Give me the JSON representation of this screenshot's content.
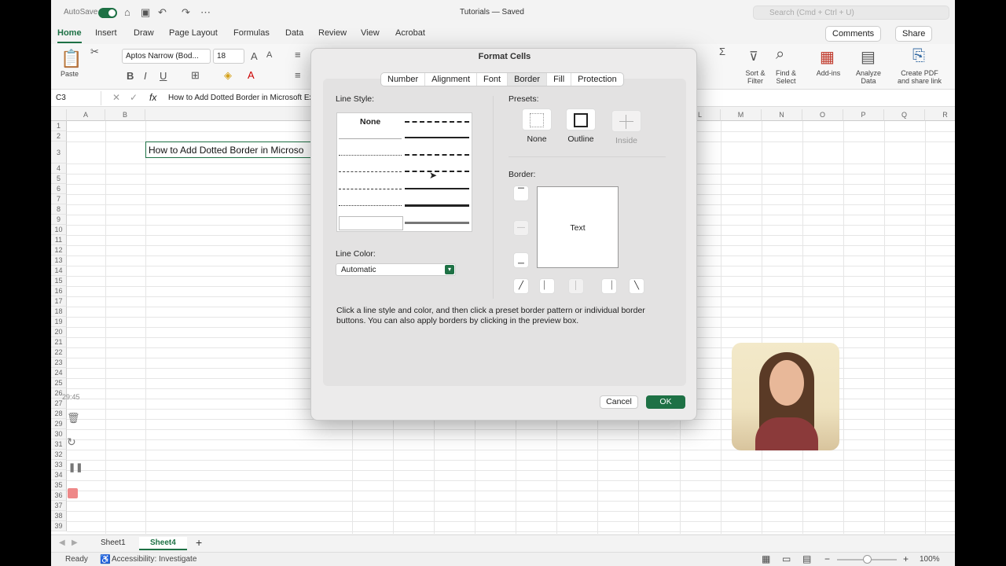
{
  "titlebar": {
    "autosave_label": "AutoSave",
    "doc_title": "Tutorials — Saved",
    "search_placeholder": "Search (Cmd + Ctrl + U)"
  },
  "ribbon_tabs": [
    "Home",
    "Insert",
    "Draw",
    "Page Layout",
    "Formulas",
    "Data",
    "Review",
    "View",
    "Acrobat"
  ],
  "ribbon_actions": {
    "comments": "Comments",
    "share": "Share"
  },
  "ribbon": {
    "paste": "Paste",
    "font_name": "Aptos Narrow (Bod...",
    "font_size": "18",
    "sort_filter": "Sort & Filter",
    "find_select": "Find & Select",
    "add_ins": "Add-ins",
    "analyze": "Analyze Data",
    "create_pdf": "Create PDF and share link"
  },
  "formula_bar": {
    "name_box": "C3",
    "fx": "fx",
    "content": "How to Add Dotted Border in Microsoft Ex"
  },
  "grid": {
    "columns": [
      "A",
      "B",
      "C",
      "L",
      "M",
      "N",
      "O",
      "P",
      "Q",
      "R"
    ],
    "rows": [
      "1",
      "2",
      "3",
      "4",
      "5",
      "6",
      "7",
      "8",
      "9",
      "10",
      "11",
      "12",
      "13",
      "14",
      "15",
      "16",
      "17",
      "18",
      "19",
      "20",
      "21",
      "22",
      "23",
      "24",
      "25",
      "26",
      "27",
      "28",
      "29",
      "30",
      "31",
      "32",
      "33",
      "34",
      "35",
      "36",
      "37",
      "38",
      "39"
    ],
    "cell_c3": "How to Add Dotted Border in Microso"
  },
  "sheets": {
    "sheet1": "Sheet1",
    "sheet4": "Sheet4",
    "add": "+"
  },
  "status": {
    "ready": "Ready",
    "accessibility": "Accessibility: Investigate",
    "zoom": "100%"
  },
  "recorder": {
    "time": "29:45"
  },
  "dialog": {
    "title": "Format Cells",
    "tabs": [
      "Number",
      "Alignment",
      "Font",
      "Border",
      "Fill",
      "Protection"
    ],
    "active_tab": "Border",
    "line_style_label": "Line Style:",
    "line_style_none": "None",
    "line_color_label": "Line Color:",
    "line_color_value": "Automatic",
    "presets_label": "Presets:",
    "presets": [
      "None",
      "Outline",
      "Inside"
    ],
    "border_label": "Border:",
    "preview_text": "Text",
    "help_line1": "Click a line style and color, and then click a preset border pattern or individual border",
    "help_line2": "buttons. You can also apply borders by clicking in the preview box.",
    "cancel": "Cancel",
    "ok": "OK"
  }
}
